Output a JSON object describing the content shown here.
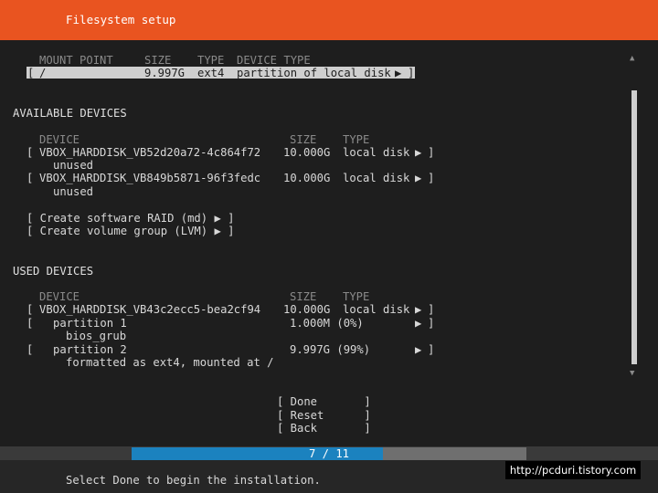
{
  "header": {
    "title": "Filesystem setup"
  },
  "summary": {
    "columns": {
      "mount_point": "MOUNT POINT",
      "size": "SIZE",
      "type": "TYPE",
      "device_type": "DEVICE TYPE"
    },
    "row": {
      "open": "[",
      "mount_point": "/",
      "size": "9.997G",
      "type": "ext4",
      "device_type": "partition of local disk",
      "arrow": "▶",
      "close": "]"
    }
  },
  "available": {
    "title": "AVAILABLE DEVICES",
    "columns": {
      "device": "DEVICE",
      "size": "SIZE",
      "type": "TYPE"
    },
    "devices": [
      {
        "open": "[",
        "name": "VBOX_HARDDISK_VB52d20a72-4c864f72",
        "size": "10.000G",
        "type": "local disk",
        "arrow": "▶",
        "close": "]",
        "note": "unused"
      },
      {
        "open": "[",
        "name": "VBOX_HARDDISK_VB849b5871-96f3fedc",
        "size": "10.000G",
        "type": "local disk",
        "arrow": "▶",
        "close": "]",
        "note": "unused"
      }
    ],
    "actions": [
      "[ Create software RAID (md) ▶ ]",
      "[ Create volume group (LVM) ▶ ]"
    ]
  },
  "used": {
    "title": "USED DEVICES",
    "columns": {
      "device": "DEVICE",
      "size": "SIZE",
      "type": "TYPE"
    },
    "disk": {
      "open": "[",
      "name": "VBOX_HARDDISK_VB43c2ecc5-bea2cf94",
      "size": "10.000G",
      "type": "local disk",
      "arrow": "▶",
      "close": "]"
    },
    "partitions": [
      {
        "open": "[",
        "name": "partition 1",
        "size": "1.000M (0%)",
        "arrow": "▶",
        "close": "]",
        "note": "bios_grub"
      },
      {
        "open": "[",
        "name": "partition 2",
        "size": "9.997G (99%)",
        "arrow": "▶",
        "close": "]",
        "note": "formatted as ext4, mounted at /"
      }
    ]
  },
  "buttons": {
    "done": "[ Done       ]",
    "reset": "[ Reset      ]",
    "back": "[ Back       ]"
  },
  "scrollbar": {
    "up_icon": "▲",
    "down_icon": "▼"
  },
  "progress": {
    "label": "7 / 11",
    "current": 7,
    "total": 11
  },
  "footer": {
    "message": "Select Done to begin the installation."
  },
  "watermark": "http://pcduri.tistory.com",
  "colors": {
    "header": "#e95420",
    "background": "#1e1e1e",
    "progress_fill": "#1b82bf",
    "progress_track": "#6f6f6f"
  }
}
